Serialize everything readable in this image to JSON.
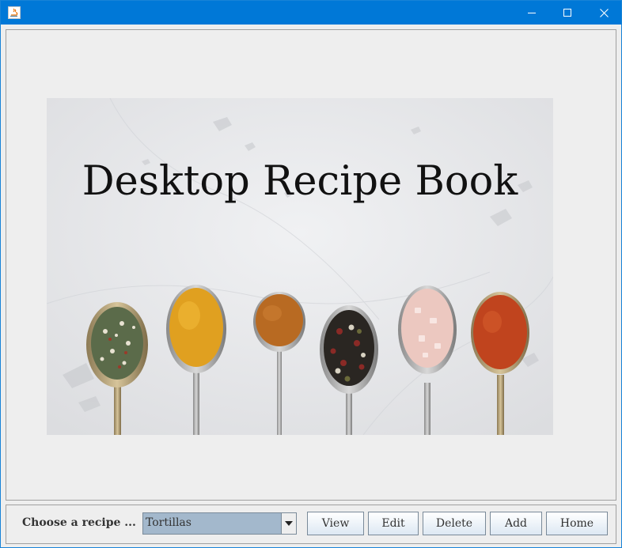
{
  "window": {
    "title": ""
  },
  "titlebar": {
    "icons": [
      "java-icon",
      "minimize-icon",
      "maximize-icon",
      "close-icon"
    ]
  },
  "hero": {
    "title": "Desktop Recipe Book"
  },
  "bottom_bar": {
    "choose_label": "Choose a recipe ...",
    "recipe_select": {
      "value": "Tortillas"
    },
    "buttons": {
      "view": "View",
      "edit": "Edit",
      "delete": "Delete",
      "add": "Add",
      "home": "Home"
    }
  },
  "colors": {
    "titlebar": "#0078d7",
    "combo_bg": "#a3b8cc"
  }
}
